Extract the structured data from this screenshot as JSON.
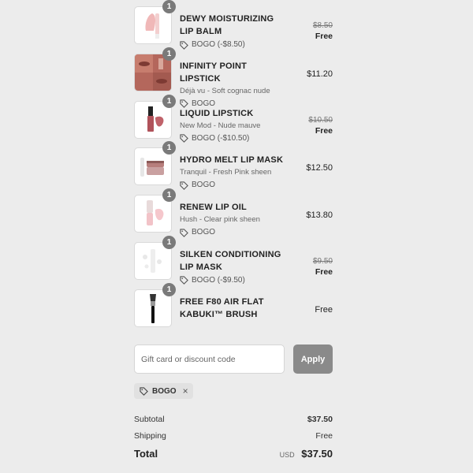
{
  "items": [
    {
      "name": "DEWY MOISTURIZING LIP BALM",
      "qty": "1",
      "variant": "",
      "discount": "BOGO (-$8.50)",
      "original_price": "$8.50",
      "price": "Free"
    },
    {
      "name": "INFINITY POINT LIPSTICK",
      "qty": "1",
      "variant": "Déjà vu - Soft cognac nude",
      "discount": "BOGO",
      "original_price": "",
      "price": "$11.20"
    },
    {
      "name": "LIQUID LIPSTICK",
      "qty": "1",
      "variant": "New Mod - Nude mauve",
      "discount": "BOGO (-$10.50)",
      "original_price": "$10.50",
      "price": "Free"
    },
    {
      "name": "HYDRO MELT LIP MASK",
      "qty": "1",
      "variant": "Tranquil - Fresh Pink sheen",
      "discount": "BOGO",
      "original_price": "",
      "price": "$12.50"
    },
    {
      "name": "RENEW LIP OIL",
      "qty": "1",
      "variant": "Hush - Clear pink sheen",
      "discount": "BOGO",
      "original_price": "",
      "price": "$13.80"
    },
    {
      "name": "SILKEN CONDITIONING LIP MASK",
      "qty": "1",
      "variant": "",
      "discount": "BOGO (-$9.50)",
      "original_price": "$9.50",
      "price": "Free"
    },
    {
      "name": "FREE F80 AIR FLAT KABUKI™ BRUSH",
      "qty": "1",
      "variant": "",
      "discount": "",
      "original_price": "",
      "price": "Free"
    }
  ],
  "discount_form": {
    "placeholder": "Gift card or discount code",
    "apply_label": "Apply"
  },
  "applied_code": {
    "label": "BOGO",
    "remove": "×"
  },
  "summary": {
    "subtotal_label": "Subtotal",
    "subtotal_value": "$37.50",
    "shipping_label": "Shipping",
    "shipping_value": "Free",
    "total_label": "Total",
    "currency": "USD",
    "total_value": "$37.50"
  }
}
